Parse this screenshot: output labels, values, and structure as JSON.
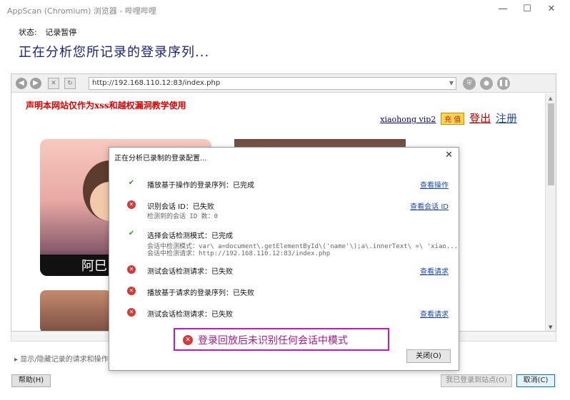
{
  "window": {
    "title": "AppScan (Chromium) 浏览器 - 哔哩哔哩",
    "controls": [
      "—",
      "☐",
      "✕"
    ]
  },
  "status": {
    "label": "状态:",
    "value": "记录暂停"
  },
  "heading": "正在分析您所记录的登录序列...",
  "browser": {
    "url": "http://192.168.110.12:83/index.php",
    "page": {
      "declaration": "声明本网站仅作为xss和越权漏洞教学使用",
      "username": "xiaohong vip2",
      "charge_label": "充 值",
      "logout_label": "登出",
      "register_label": "注册",
      "poster_caption": "阿巳"
    }
  },
  "dialog": {
    "title": "正在分析已录制的登录配置...",
    "steps": [
      {
        "status": "ok",
        "label": "播放基于操作的登录序列：已完成",
        "link": "查看操作"
      },
      {
        "status": "fail",
        "label": "识别会话 ID：已失败",
        "link": "查看会话 ID",
        "sub": [
          "检测到的会话 ID 数：0"
        ]
      },
      {
        "status": "ok",
        "label": "选择会话检测模式：已完成",
        "sub": [
          "会话中检测模式：var\\ a=document\\.getElementById\\('name'\\);a\\.innerText\\ =\\ 'xiao...",
          "会话中检测请求：http://192.168.110.12:83/index.php"
        ]
      },
      {
        "status": "fail",
        "label": "测试会话检测请求：已失败",
        "link": "查看请求"
      },
      {
        "status": "fail",
        "label": "播放基于请求的登录序列：已失败"
      },
      {
        "status": "fail",
        "label": "测试会话检测请求：已失败",
        "link": "查看请求"
      }
    ],
    "banner": "登录回放后未识别任何会话中模式",
    "close_button": "关闭(O)"
  },
  "footer": {
    "toggle_label": "▸ 显示/隐藏记录的请求和操作",
    "help_button": "帮助(H)",
    "logged_in_button": "我已登录到站点(O)",
    "cancel_button": "取消(C)"
  },
  "icons": {
    "ok": "checkmark-icon",
    "fail": "error-circle-icon"
  },
  "colors": {
    "heading": "#1a237e",
    "declaration": "#e00000",
    "banner_border": "#c218c2",
    "banner_text": "#b0158e",
    "fail": "#d23b3b",
    "ok": "#2e9a2e"
  }
}
